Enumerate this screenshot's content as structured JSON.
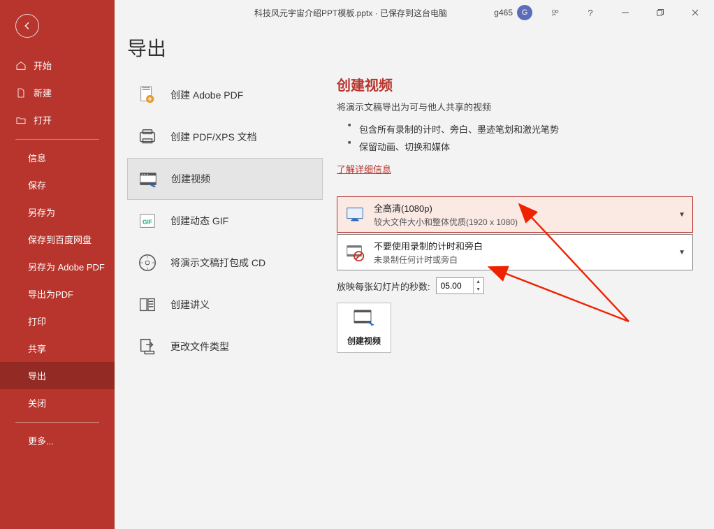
{
  "titlebar": {
    "doc_title": "科技风元宇宙介绍PPT模板.pptx · 已保存到这台电脑",
    "user_name": "g465",
    "user_initial": "G"
  },
  "sidebar": {
    "home": "开始",
    "new": "新建",
    "open": "打开",
    "info": "信息",
    "save": "保存",
    "saveas": "另存为",
    "save_baidu": "保存到百度网盘",
    "save_adobe": "另存为 Adobe PDF",
    "export_pdf": "导出为PDF",
    "print": "打印",
    "share": "共享",
    "export": "导出",
    "close": "关闭",
    "more": "更多..."
  },
  "page": {
    "title": "导出"
  },
  "options": {
    "adobe_pdf": "创建 Adobe PDF",
    "pdf_xps": "创建 PDF/XPS 文档",
    "video": "创建视频",
    "gif": "创建动态 GIF",
    "package_cd": "将演示文稿打包成 CD",
    "handouts": "创建讲义",
    "change_type": "更改文件类型"
  },
  "panel": {
    "heading": "创建视频",
    "desc": "将演示文稿导出为可与他人共享的视频",
    "bullets": [
      "包含所有录制的计时、旁白、墨迹笔划和激光笔势",
      "保留动画、切换和媒体"
    ],
    "link": "了解详细信息",
    "quality": {
      "line1": "全高清(1080p)",
      "line2": "较大文件大小和整体优质(1920 x 1080)"
    },
    "timings": {
      "line1": "不要使用录制的计时和旁白",
      "line2": "未录制任何计时或旁白"
    },
    "seconds_label": "放映每张幻灯片的秒数:",
    "seconds_value": "05.00",
    "create_btn": "创建视频"
  }
}
